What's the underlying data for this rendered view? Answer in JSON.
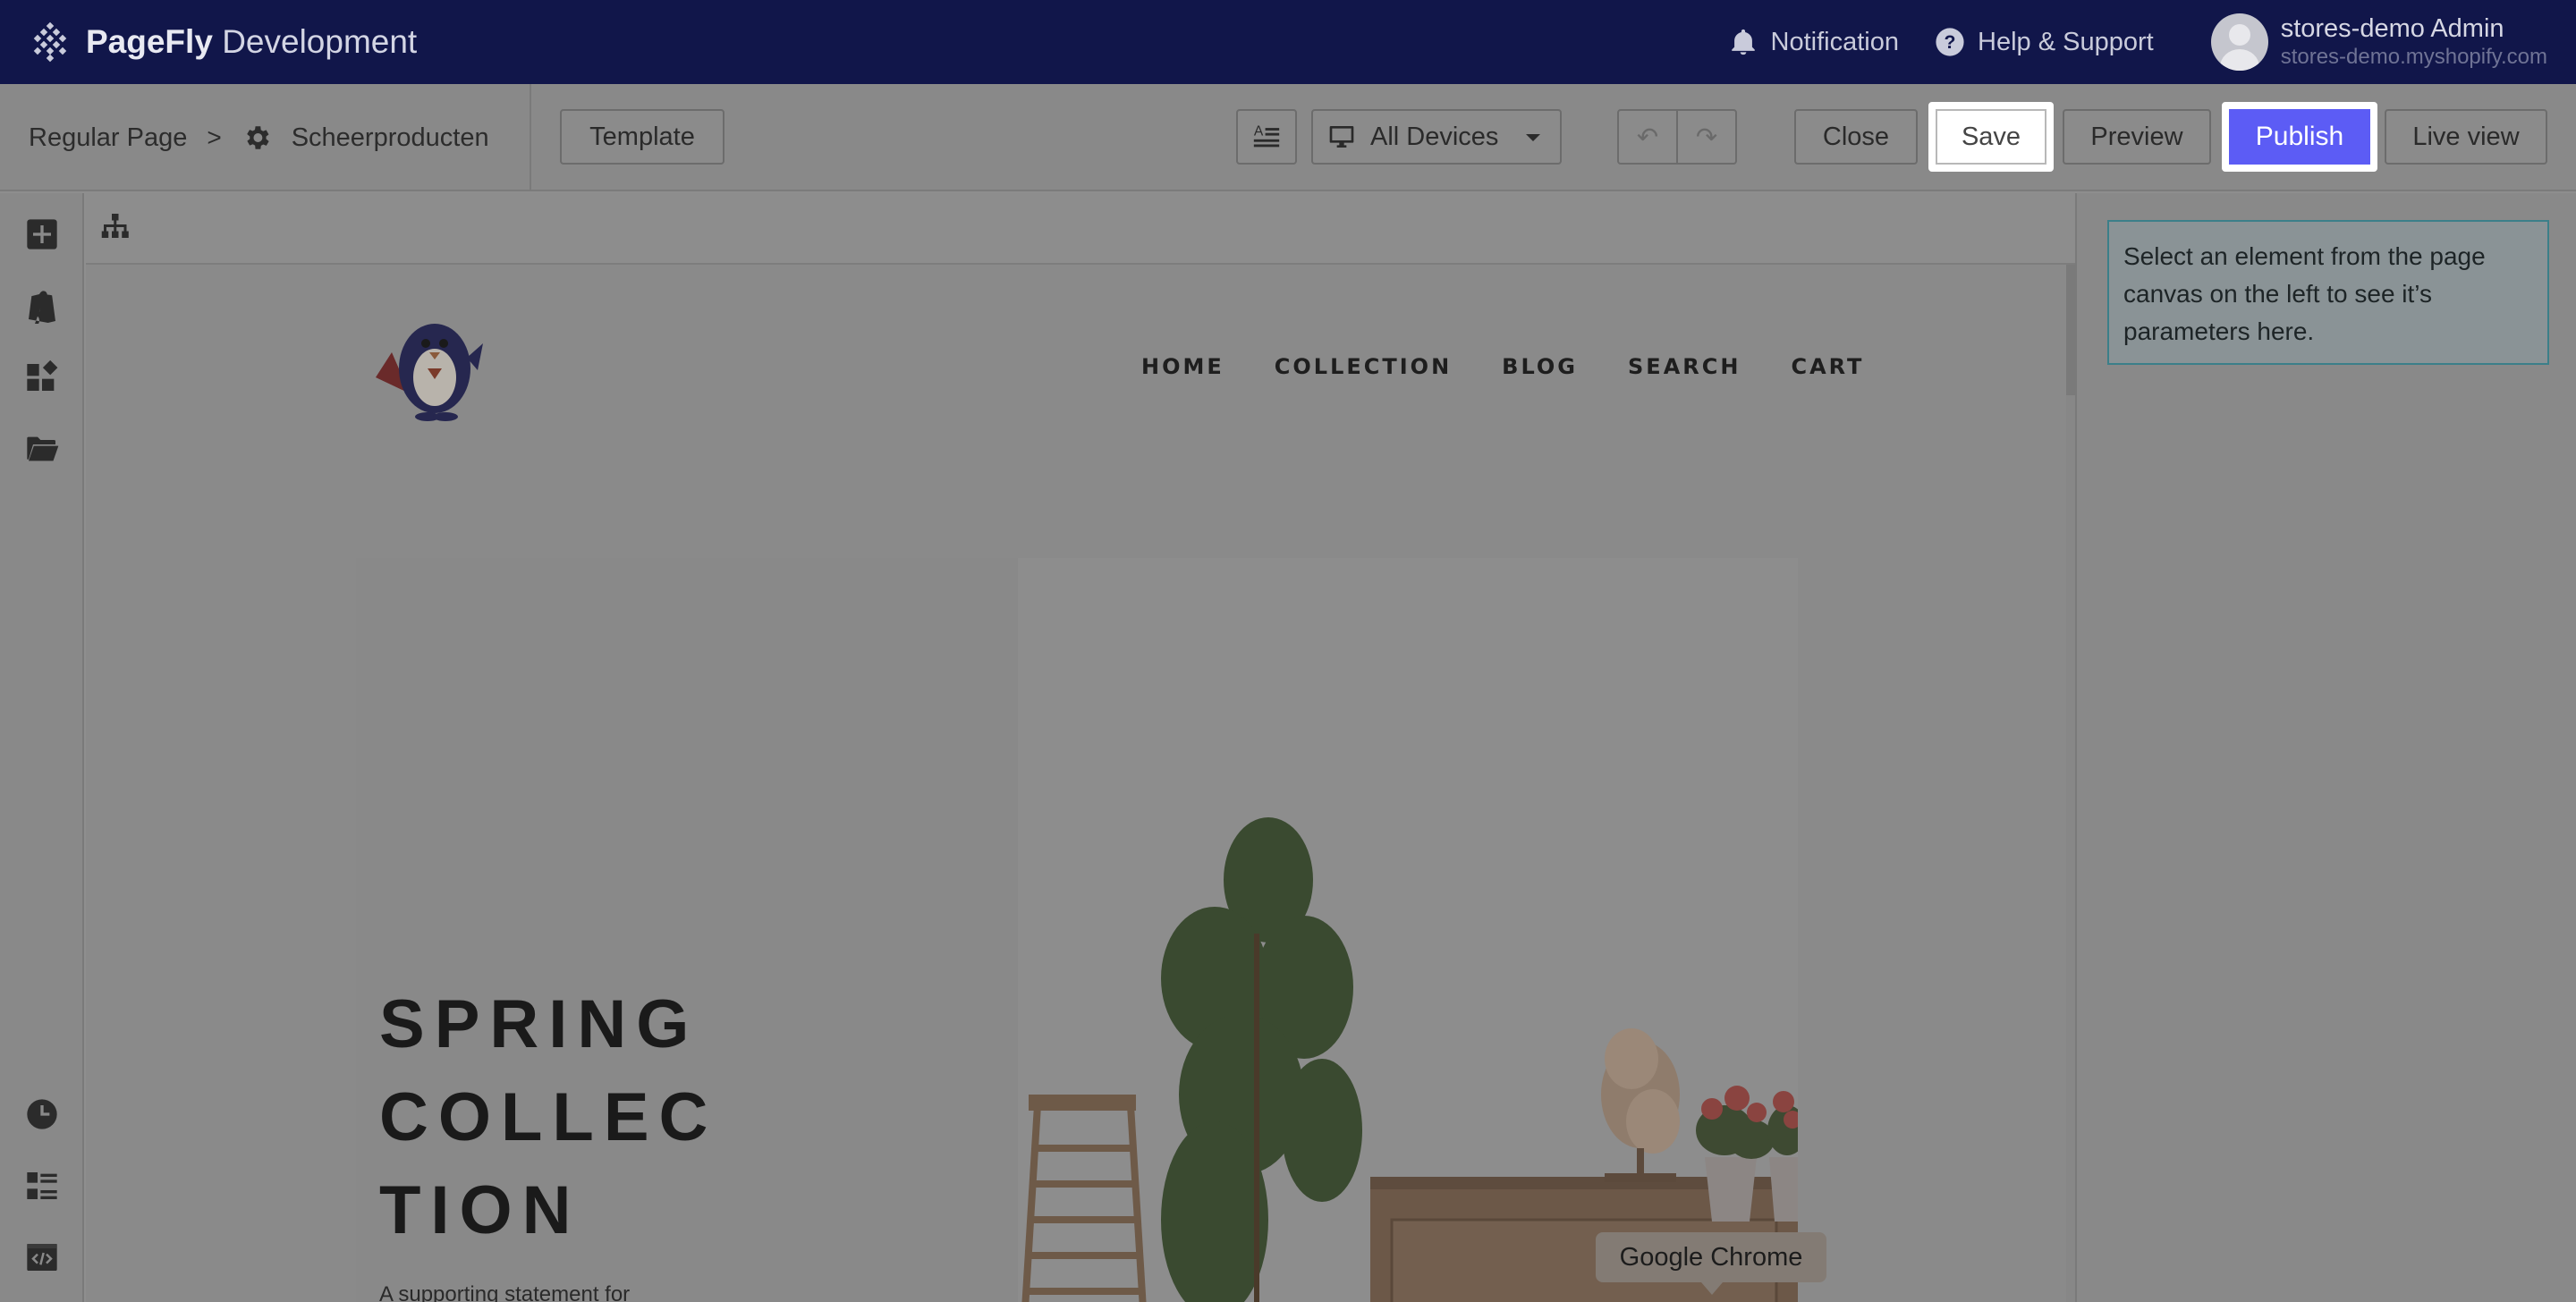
{
  "app": {
    "brand_bold": "PageFly",
    "brand_light": "Development",
    "notification_label": "Notification",
    "help_label": "Help & Support",
    "user_name": "stores-demo Admin",
    "user_domain": "stores-demo.myshopify.com"
  },
  "toolbar": {
    "breadcrumb_root": "Regular Page",
    "breadcrumb_separator": ">",
    "breadcrumb_page": "Scheerproducten",
    "template_label": "Template",
    "devices_label": "All Devices",
    "undo_label": "↶",
    "redo_label": "↷",
    "close_label": "Close",
    "save_label": "Save",
    "preview_label": "Preview",
    "publish_label": "Publish",
    "live_view_label": "Live view",
    "publish_color": "#5c5cf5"
  },
  "left_rail": {
    "icons": [
      "add-element-icon",
      "shopify-bag-icon",
      "widgets-icon",
      "folder-icon",
      "history-icon",
      "outline-list-icon",
      "code-icon"
    ]
  },
  "canvas": {
    "nav_items": [
      "HOME",
      "COLLECTION",
      "BLOG",
      "SEARCH",
      "CART"
    ],
    "hero_title": "SPRING\nCOLLEC\nTION",
    "hero_subtitle": "A supporting statement for"
  },
  "tooltip": {
    "text": "Google Chrome"
  },
  "right_panel": {
    "info_text": "Select an element from the page canvas on the left to see it’s parameters here."
  }
}
